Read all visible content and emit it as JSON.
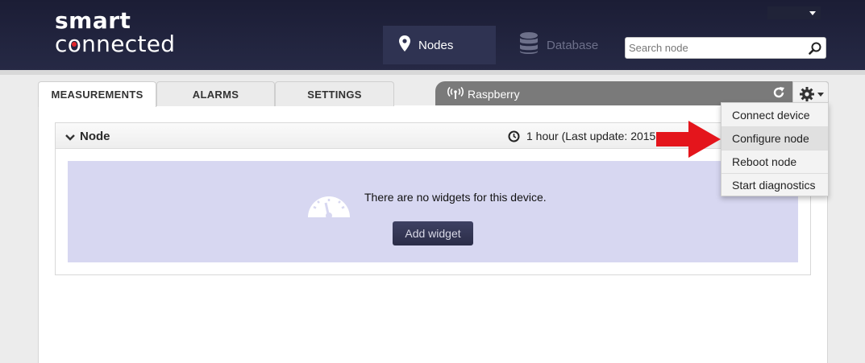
{
  "app": {
    "logo_line1": "smart",
    "logo_line2": "connected"
  },
  "header": {
    "nav": [
      {
        "label": "Nodes",
        "icon": "map-pin-icon",
        "active": true
      },
      {
        "label": "Database",
        "icon": "database-icon",
        "active": false
      }
    ],
    "search": {
      "placeholder": "Search node",
      "value": ""
    }
  },
  "tabs": [
    {
      "label": "MEASUREMENTS",
      "active": true
    },
    {
      "label": "ALARMS",
      "active": false
    },
    {
      "label": "SETTINGS",
      "active": false
    }
  ],
  "device": {
    "name": "Raspberry",
    "icons": [
      "wifi-signal-icon",
      "refresh-icon",
      "gear-icon"
    ]
  },
  "panel": {
    "title": "Node",
    "time_info": "1 hour (Last update: 2015",
    "empty_message": "There are no widgets for this device.",
    "add_widget_label": "Add widget"
  },
  "dropdown": {
    "items": [
      {
        "label": "Connect device",
        "highlighted": false
      },
      {
        "label": "Configure node",
        "highlighted": true
      },
      {
        "label": "Reboot node",
        "highlighted": false
      },
      {
        "label": "Start diagnostics",
        "highlighted": false
      }
    ]
  },
  "colors": {
    "header_bg": "#1e2038",
    "accent_red": "#e0262b",
    "widget_area_bg": "#d7d7f1",
    "button_bg": "#33365a",
    "device_bar_bg": "#7a7a7a"
  }
}
